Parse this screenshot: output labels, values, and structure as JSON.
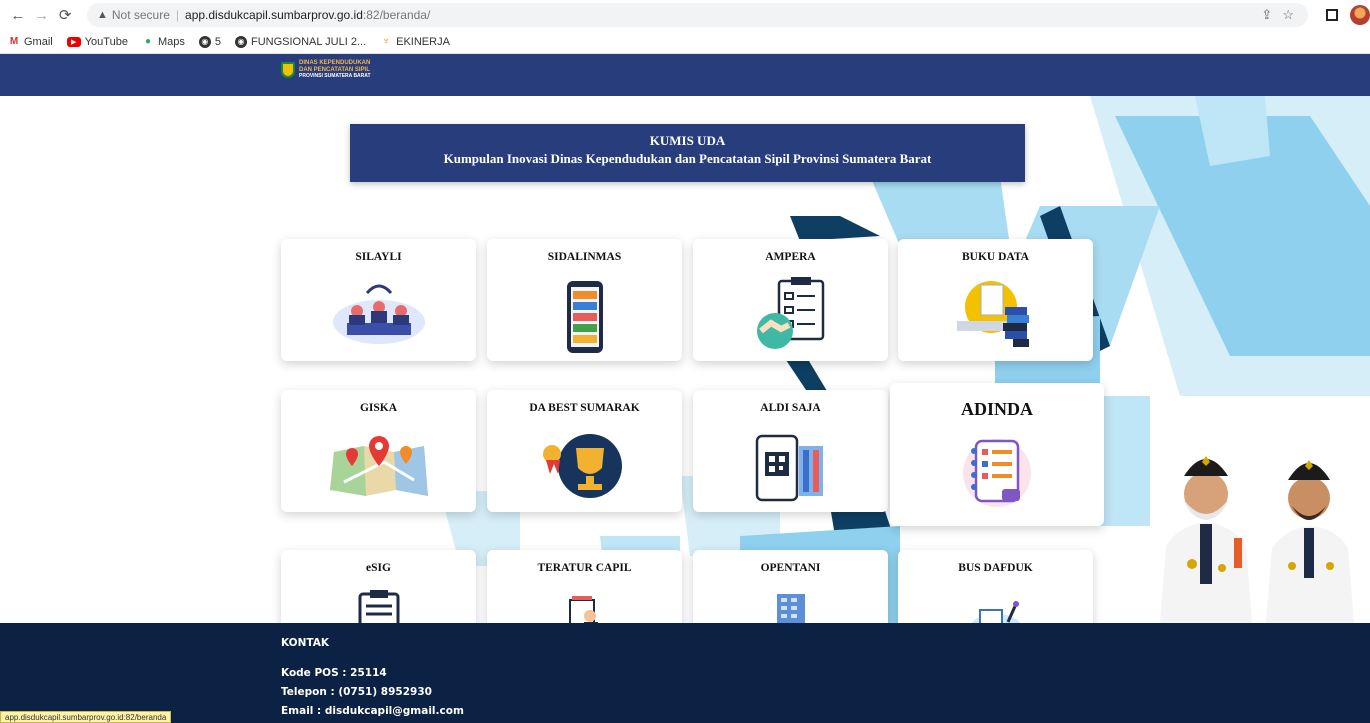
{
  "browser": {
    "security_label": "Not secure",
    "url_host": "app.disdukcapil.sumbarprov.go.id",
    "url_path": ":82/beranda/",
    "bookmarks": [
      {
        "label": "Gmail",
        "icon": "gmail-icon"
      },
      {
        "label": "YouTube",
        "icon": "youtube-icon"
      },
      {
        "label": "Maps",
        "icon": "maps-icon"
      },
      {
        "label": "5",
        "icon": "globe-icon"
      },
      {
        "label": "FUNGSIONAL JULI 2...",
        "icon": "globe-icon"
      },
      {
        "label": "EKINERJA",
        "icon": "garuda-icon"
      }
    ],
    "status_url": "app.disdukcapil.sumbarprov.go.id:82/beranda"
  },
  "header": {
    "logo_line1": "DINAS KEPENDUDUKAN",
    "logo_line2": "DAN PENCATATAN SIPIL",
    "logo_line3": "PROVINSI SUMATERA BARAT"
  },
  "banner": {
    "title": "KUMIS UDA",
    "subtitle": "Kumpulan Inovasi Dinas Kependudukan dan Pencatatan Sipil Provinsi Sumatera Barat"
  },
  "cards": [
    {
      "label": "SILAYLI"
    },
    {
      "label": "SIDALINMAS"
    },
    {
      "label": "AMPERA"
    },
    {
      "label": "BUKU DATA"
    },
    {
      "label": "GISKA"
    },
    {
      "label": "DA BEST SUMARAK"
    },
    {
      "label": "ALDI SAJA"
    },
    {
      "label": "ADINDA"
    },
    {
      "label": "eSIG"
    },
    {
      "label": "TERATUR CAPIL"
    },
    {
      "label": "OPENTANI"
    },
    {
      "label": "BUS DAFDUK"
    }
  ],
  "footer": {
    "heading": "KONTAK",
    "postal": "Kode POS : 25114",
    "phone": "Telepon   : (0751) 8952930",
    "email": "Email       : disdukcapil@gmail.com"
  },
  "colors": {
    "header": "#273d7c",
    "footer": "#0c2244",
    "accent_light": "#8fd0ee",
    "accent_dark": "#0e3f63"
  }
}
